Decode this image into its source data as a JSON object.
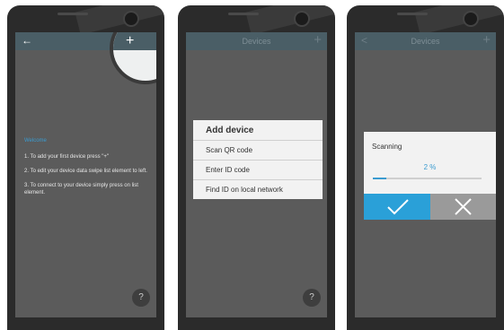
{
  "screens": [
    {
      "appbar": {
        "back_icon": "←",
        "title": "",
        "add_icon": "+"
      },
      "welcome": "Welcome",
      "steps": [
        "1. To add your first device press \"+\"",
        "2. To edit your device data swipe list element to left.",
        "3. To connect to your device simply press on list element."
      ],
      "help_label": "?"
    },
    {
      "appbar": {
        "back_icon": "",
        "title": "Devices",
        "add_icon": "+"
      },
      "dialog": {
        "title": "Add device",
        "items": [
          "Scan QR code",
          "Enter ID code",
          "Find ID on local network"
        ]
      },
      "help_label": "?"
    },
    {
      "appbar": {
        "back_icon": "<",
        "title": "Devices",
        "add_icon": "+"
      },
      "scan": {
        "title": "Scanning",
        "percent_text": "2 %",
        "progress": 0.12
      }
    }
  ],
  "colors": {
    "accent": "#2aa0d8",
    "appbar": "#4a5e66",
    "screen": "#5b5b5b"
  }
}
